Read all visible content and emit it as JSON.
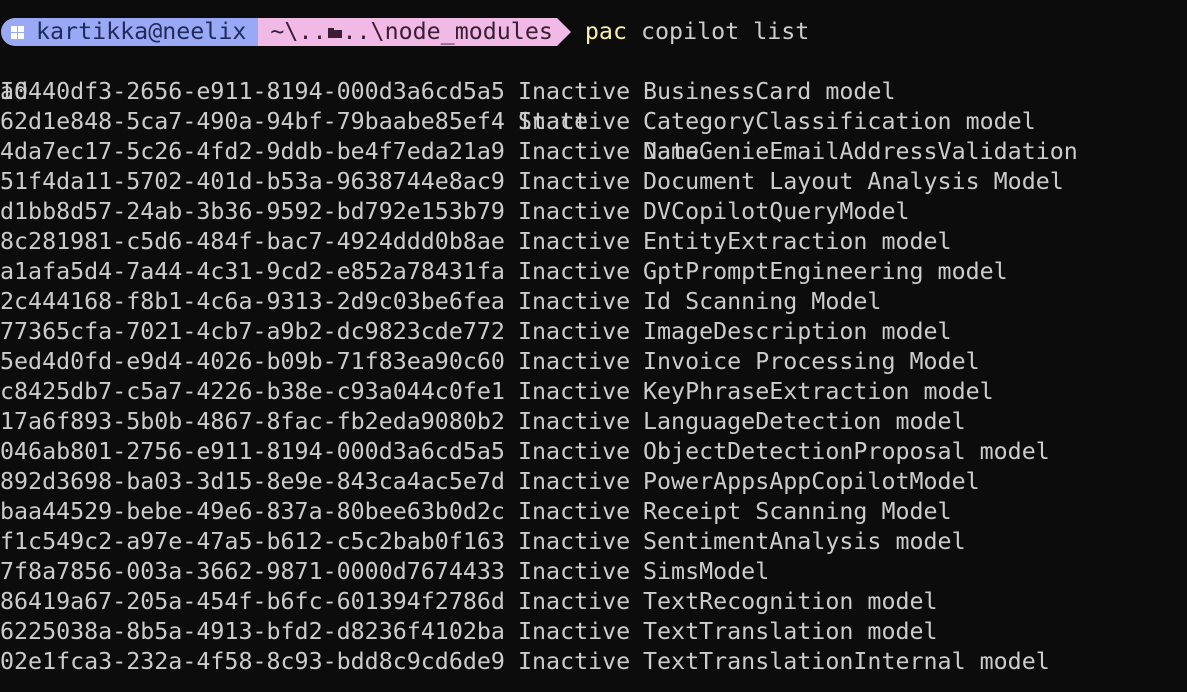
{
  "prompt": {
    "user": "kartikka@neelix",
    "path_prefix": "~\\..",
    "path_suffix": "..\\node_modules",
    "command": "pac",
    "args": "copilot list"
  },
  "table": {
    "headers": {
      "id": "Id",
      "state": "State",
      "name": "Name"
    },
    "rows": [
      {
        "id": "a0440df3-2656-e911-8194-000d3a6cd5a5",
        "state": "Inactive",
        "name": "BusinessCard model"
      },
      {
        "id": "62d1e848-5ca7-490a-94bf-79baabe85ef4",
        "state": "Inactive",
        "name": "CategoryClassification model"
      },
      {
        "id": "4da7ec17-5c26-4fd2-9ddb-be4f7eda21a9",
        "state": "Inactive",
        "name": "DataGenieEmailAddressValidation"
      },
      {
        "id": "51f4da11-5702-401d-b53a-9638744e8ac9",
        "state": "Inactive",
        "name": "Document Layout Analysis Model"
      },
      {
        "id": "d1bb8d57-24ab-3b36-9592-bd792e153b79",
        "state": "Inactive",
        "name": "DVCopilotQueryModel"
      },
      {
        "id": "8c281981-c5d6-484f-bac7-4924ddd0b8ae",
        "state": "Inactive",
        "name": "EntityExtraction model"
      },
      {
        "id": "a1afa5d4-7a44-4c31-9cd2-e852a78431fa",
        "state": "Inactive",
        "name": "GptPromptEngineering model"
      },
      {
        "id": "2c444168-f8b1-4c6a-9313-2d9c03be6fea",
        "state": "Inactive",
        "name": "Id Scanning Model"
      },
      {
        "id": "77365cfa-7021-4cb7-a9b2-dc9823cde772",
        "state": "Inactive",
        "name": "ImageDescription model"
      },
      {
        "id": "5ed4d0fd-e9d4-4026-b09b-71f83ea90c60",
        "state": "Inactive",
        "name": "Invoice Processing Model"
      },
      {
        "id": "c8425db7-c5a7-4226-b38e-c93a044c0fe1",
        "state": "Inactive",
        "name": "KeyPhraseExtraction model"
      },
      {
        "id": "17a6f893-5b0b-4867-8fac-fb2eda9080b2",
        "state": "Inactive",
        "name": "LanguageDetection model"
      },
      {
        "id": "046ab801-2756-e911-8194-000d3a6cd5a5",
        "state": "Inactive",
        "name": "ObjectDetectionProposal model"
      },
      {
        "id": "892d3698-ba03-3d15-8e9e-843ca4ac5e7d",
        "state": "Inactive",
        "name": "PowerAppsAppCopilotModel"
      },
      {
        "id": "baa44529-bebe-49e6-837a-80bee63b0d2c",
        "state": "Inactive",
        "name": "Receipt Scanning Model"
      },
      {
        "id": "f1c549c2-a97e-47a5-b612-c5c2bab0f163",
        "state": "Inactive",
        "name": "SentimentAnalysis model"
      },
      {
        "id": "7f8a7856-003a-3662-9871-0000d7674433",
        "state": "Inactive",
        "name": "SimsModel"
      },
      {
        "id": "86419a67-205a-454f-b6fc-601394f2786d",
        "state": "Inactive",
        "name": "TextRecognition model"
      },
      {
        "id": "6225038a-8b5a-4913-bfd2-d8236f4102ba",
        "state": "Inactive",
        "name": "TextTranslation model"
      },
      {
        "id": "02e1fca3-232a-4f58-8c93-bdd8c9cd6de9",
        "state": "Inactive",
        "name": "TextTranslationInternal model"
      }
    ]
  },
  "icons": {
    "os": "windows-icon",
    "folder": "folder-icon"
  },
  "colors": {
    "background": "#0c0c0c",
    "text": "#cccccc",
    "user_segment": "#9aa9f5",
    "path_segment": "#f0b9e6",
    "command": "#f9f1a5"
  }
}
